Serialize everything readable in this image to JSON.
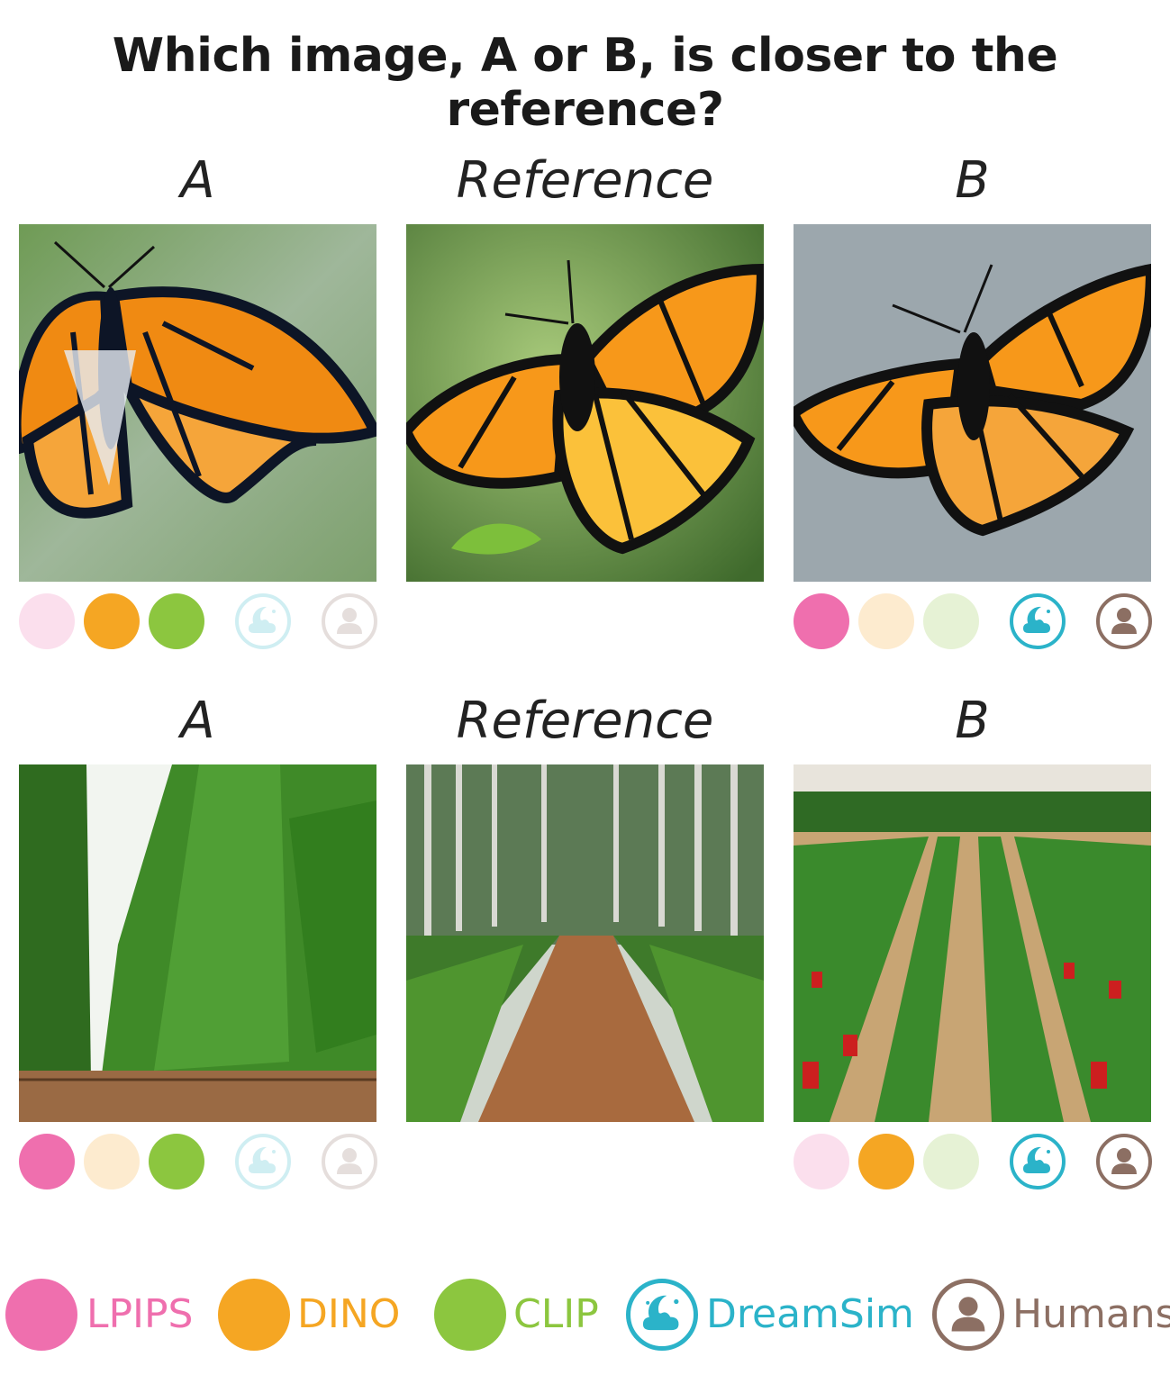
{
  "title": "Which image, A or B, is closer to the reference?",
  "rows": [
    {
      "labels": {
        "a": "A",
        "reference": "Reference",
        "b": "B"
      },
      "subject": "monarch butterfly",
      "votes": {
        "a": {
          "lpips": false,
          "dino": true,
          "clip": true,
          "dreamsim": false,
          "humans": false
        },
        "b": {
          "lpips": true,
          "dino": false,
          "clip": false,
          "dreamsim": true,
          "humans": true
        }
      }
    },
    {
      "labels": {
        "a": "A",
        "reference": "Reference",
        "b": "B"
      },
      "subject": "tree plantation rows",
      "votes": {
        "a": {
          "lpips": true,
          "dino": false,
          "clip": true,
          "dreamsim": false,
          "humans": false
        },
        "b": {
          "lpips": false,
          "dino": true,
          "clip": false,
          "dreamsim": true,
          "humans": true
        }
      }
    }
  ],
  "legend": [
    {
      "key": "lpips",
      "label": "LPIPS",
      "color": "#ef6fae"
    },
    {
      "key": "dino",
      "label": "DINO",
      "color": "#f5a623"
    },
    {
      "key": "clip",
      "label": "CLIP",
      "color": "#8cc63f"
    },
    {
      "key": "dreamsim",
      "label": "DreamSim",
      "color": "#2bb3c9",
      "icon": "dreamsim-moon-cloud-icon"
    },
    {
      "key": "humans",
      "label": "Humans",
      "color": "#8c6f63",
      "icon": "person-icon"
    }
  ]
}
